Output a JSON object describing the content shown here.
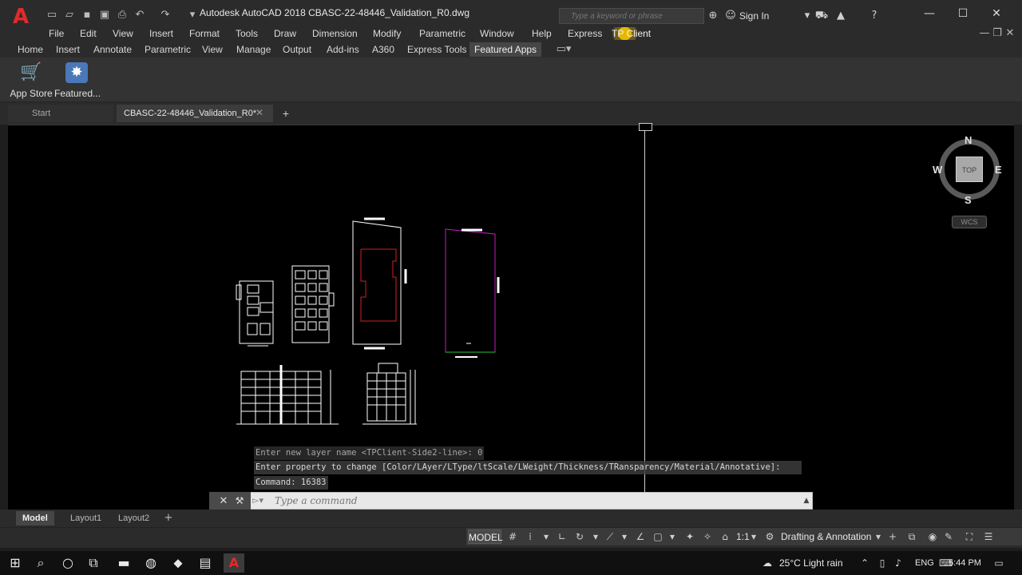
{
  "app": {
    "window_title": "Autodesk AutoCAD 2018      CBASC-22-48446_Validation_R0.dwg",
    "logo_letter": "A"
  },
  "search": {
    "placeholder": "Type a keyword or phrase"
  },
  "account": {
    "sign_in_label": "Sign In"
  },
  "menu": {
    "items": [
      "File",
      "Edit",
      "View",
      "Insert",
      "Format",
      "Tools",
      "Draw",
      "Dimension",
      "Modify",
      "Parametric",
      "Window",
      "Help",
      "Express",
      "TP Client"
    ]
  },
  "ribbon": {
    "tabs": [
      "Home",
      "Insert",
      "Annotate",
      "Parametric",
      "View",
      "Manage",
      "Output",
      "Add-ins",
      "A360",
      "Express Tools",
      "Featured Apps"
    ],
    "active_tab": "Featured Apps",
    "buttons": [
      {
        "label": "App Store",
        "icon": "cart-icon"
      },
      {
        "label": "Featured...",
        "icon": "featured-apps-icon"
      }
    ]
  },
  "document_tabs": {
    "start_label": "Start",
    "active_label": "CBASC-22-48446_Validation_R0*"
  },
  "viewcube": {
    "north": "N",
    "south": "S",
    "east": "E",
    "west": "W",
    "face_label": "TOP",
    "ucs_label": "WCS"
  },
  "command": {
    "history": [
      "Enter new layer name <TPClient-Side2-line>: 0",
      "Enter property to change [Color/LAyer/LType/ltScale/LWeight/Thickness/TRansparency/Material/Annotative]:",
      "Command: 16383"
    ],
    "input_placeholder": "Type a command"
  },
  "layout_tabs": [
    "Model",
    "Layout1",
    "Layout2"
  ],
  "status": {
    "model_label": "MODEL",
    "annotation_scale": "1:1",
    "workspace": "Drafting & Annotation"
  },
  "taskbar": {
    "weather": "25°C  Light rain",
    "language": "ENG",
    "time": "5:44 PM"
  },
  "colors": {
    "accent_red": "#e02b2b",
    "drawing_red": "#d02020",
    "drawing_magenta": "#c020c0",
    "highlight_yellow": "#e6b800"
  }
}
